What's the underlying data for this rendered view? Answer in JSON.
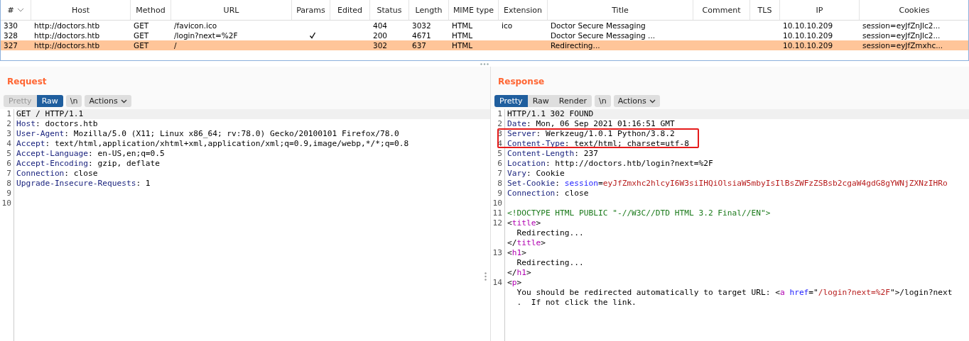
{
  "table": {
    "columns": [
      {
        "label": "#",
        "sorted": true
      },
      {
        "label": "Host"
      },
      {
        "label": "Method"
      },
      {
        "label": "URL"
      },
      {
        "label": "Params"
      },
      {
        "label": "Edited"
      },
      {
        "label": "Status"
      },
      {
        "label": "Length"
      },
      {
        "label": "MIME type"
      },
      {
        "label": "Extension"
      },
      {
        "label": "Title"
      },
      {
        "label": "Comment"
      },
      {
        "label": "TLS"
      },
      {
        "label": "IP"
      },
      {
        "label": "Cookies"
      }
    ],
    "rows": [
      {
        "selected": false,
        "params": false,
        "cells": [
          "330",
          "http://doctors.htb",
          "GET",
          "/favicon.ico",
          "",
          "",
          "404",
          "3032",
          "HTML",
          "ico",
          "Doctor Secure Messaging",
          "",
          "",
          "10.10.10.209",
          "session=eyJfZnJlc2..."
        ]
      },
      {
        "selected": false,
        "params": true,
        "cells": [
          "328",
          "http://doctors.htb",
          "GET",
          "/login?next=%2F",
          "",
          "",
          "200",
          "4671",
          "HTML",
          "",
          "Doctor Secure Messaging ...",
          "",
          "",
          "10.10.10.209",
          "session=eyJfZnJlc2..."
        ]
      },
      {
        "selected": true,
        "params": false,
        "cells": [
          "327",
          "http://doctors.htb",
          "GET",
          "/",
          "",
          "",
          "302",
          "637",
          "HTML",
          "",
          "Redirecting...",
          "",
          "",
          "10.10.10.209",
          "session=eyJfZmxhc..."
        ]
      }
    ]
  },
  "panes": [
    {
      "title": "Request",
      "tabs": [
        {
          "label": "Pretty",
          "selected": false,
          "disabled": true
        },
        {
          "label": "Raw",
          "selected": true,
          "disabled": false
        }
      ],
      "newline_button": "\\n",
      "actions_button": "Actions",
      "lines": [
        {
          "number": "1",
          "tokens": [
            {
              "kind": "plain",
              "text": "GET / HTTP/1.1"
            }
          ]
        },
        {
          "number": "2",
          "tokens": [
            {
              "kind": "name",
              "text": "Host"
            },
            {
              "kind": "plain",
              "text": ": doctors.htb"
            }
          ]
        },
        {
          "number": "3",
          "tokens": [
            {
              "kind": "name",
              "text": "User-Agent"
            },
            {
              "kind": "plain",
              "text": ": Mozilla/5.0 (X11; Linux x86_64; rv:78.0) Gecko/20100101 Firefox/78.0"
            }
          ]
        },
        {
          "number": "4",
          "tokens": [
            {
              "kind": "name",
              "text": "Accept"
            },
            {
              "kind": "plain",
              "text": ": text/html,application/xhtml+xml,application/xml;q=0.9,image/webp,*/*;q=0.8"
            }
          ]
        },
        {
          "number": "5",
          "tokens": [
            {
              "kind": "name",
              "text": "Accept-Language"
            },
            {
              "kind": "plain",
              "text": ": en-US,en;q=0.5"
            }
          ]
        },
        {
          "number": "6",
          "tokens": [
            {
              "kind": "name",
              "text": "Accept-Encoding"
            },
            {
              "kind": "plain",
              "text": ": gzip, deflate"
            }
          ]
        },
        {
          "number": "7",
          "tokens": [
            {
              "kind": "name",
              "text": "Connection"
            },
            {
              "kind": "plain",
              "text": ": close"
            }
          ]
        },
        {
          "number": "8",
          "tokens": [
            {
              "kind": "name",
              "text": "Upgrade-Insecure-Requests"
            },
            {
              "kind": "plain",
              "text": ": 1"
            }
          ]
        },
        {
          "number": "9"
        },
        {
          "number": "10"
        }
      ]
    },
    {
      "title": "Response",
      "tabs": [
        {
          "label": "Pretty",
          "selected": true,
          "disabled": false
        },
        {
          "label": "Raw",
          "selected": false,
          "disabled": false
        },
        {
          "label": "Render",
          "selected": false,
          "disabled": false
        }
      ],
      "newline_button": "\\n",
      "actions_button": "Actions",
      "lines": [
        {
          "number": "1",
          "tokens": [
            {
              "kind": "plain",
              "text": "HTTP/1.1 302 FOUND"
            }
          ]
        },
        {
          "number": "2",
          "tokens": [
            {
              "kind": "name",
              "text": "Date"
            },
            {
              "kind": "plain",
              "text": ": Mon, 06 Sep 2021 01:16:51 GMT"
            }
          ]
        },
        {
          "number": "3",
          "tokens": [
            {
              "kind": "name",
              "text": "Server"
            },
            {
              "kind": "plain",
              "text": ": Werkzeug/1.0.1 Python/3.8.2"
            }
          ]
        },
        {
          "number": "4",
          "tokens": [
            {
              "kind": "name",
              "text": "Content-Type"
            },
            {
              "kind": "plain",
              "text": ": text/html; charset=utf-8"
            }
          ]
        },
        {
          "number": "5",
          "tokens": [
            {
              "kind": "name",
              "text": "Content-Length"
            },
            {
              "kind": "plain",
              "text": ": 237"
            }
          ]
        },
        {
          "number": "6",
          "tokens": [
            {
              "kind": "name",
              "text": "Location"
            },
            {
              "kind": "plain",
              "text": ": http://doctors.htb/login?next=%2F"
            }
          ]
        },
        {
          "number": "7",
          "tokens": [
            {
              "kind": "name",
              "text": "Vary"
            },
            {
              "kind": "plain",
              "text": ": Cookie"
            }
          ]
        },
        {
          "number": "8",
          "tokens": [
            {
              "kind": "name",
              "text": "Set-Cookie"
            },
            {
              "kind": "plain",
              "text": ": "
            },
            {
              "kind": "attr",
              "text": "session"
            },
            {
              "kind": "plain",
              "text": "="
            },
            {
              "kind": "string",
              "text": "eyJfZmxhc2hlcyI6W3siIHQiOlsiaW5mbyIsIlBsZWFzZSBsb2cgaW4gdG8gYWNjZXNzIHRo"
            }
          ]
        },
        {
          "number": "9",
          "tokens": [
            {
              "kind": "name",
              "text": "Connection"
            },
            {
              "kind": "plain",
              "text": ": close"
            }
          ]
        },
        {
          "number": "10"
        },
        {
          "number": "11",
          "tokens": [
            {
              "kind": "doctype",
              "text": "<!DOCTYPE HTML PUBLIC \"-//W3C//DTD HTML 3.2 Final//EN\">"
            }
          ]
        },
        {
          "number": "12",
          "tokens": [
            {
              "kind": "plain",
              "text": "<"
            },
            {
              "kind": "tag",
              "text": "title"
            },
            {
              "kind": "plain",
              "text": ">"
            }
          ]
        },
        {
          "tokens": [
            {
              "kind": "plain",
              "text": "  Redirecting..."
            }
          ]
        },
        {
          "tokens": [
            {
              "kind": "plain",
              "text": "</"
            },
            {
              "kind": "tag",
              "text": "title"
            },
            {
              "kind": "plain",
              "text": ">"
            }
          ]
        },
        {
          "number": "13",
          "tokens": [
            {
              "kind": "plain",
              "text": "<"
            },
            {
              "kind": "tag",
              "text": "h1"
            },
            {
              "kind": "plain",
              "text": ">"
            }
          ]
        },
        {
          "tokens": [
            {
              "kind": "plain",
              "text": "  Redirecting..."
            }
          ]
        },
        {
          "tokens": [
            {
              "kind": "plain",
              "text": "</"
            },
            {
              "kind": "tag",
              "text": "h1"
            },
            {
              "kind": "plain",
              "text": ">"
            }
          ]
        },
        {
          "number": "14",
          "tokens": [
            {
              "kind": "plain",
              "text": "<"
            },
            {
              "kind": "tag",
              "text": "p"
            },
            {
              "kind": "plain",
              "text": ">"
            }
          ]
        },
        {
          "tokens": [
            {
              "kind": "plain",
              "text": "  You should be redirected automatically to target URL: <"
            },
            {
              "kind": "tag",
              "text": "a"
            },
            {
              "kind": "attr",
              "text": " href"
            },
            {
              "kind": "plain",
              "text": "=\""
            },
            {
              "kind": "string",
              "text": "/login?next=%2F"
            },
            {
              "kind": "plain",
              "text": "\">/login?next"
            }
          ]
        },
        {
          "tokens": [
            {
              "kind": "plain",
              "text": "  .  If not click the link."
            }
          ]
        }
      ]
    }
  ]
}
